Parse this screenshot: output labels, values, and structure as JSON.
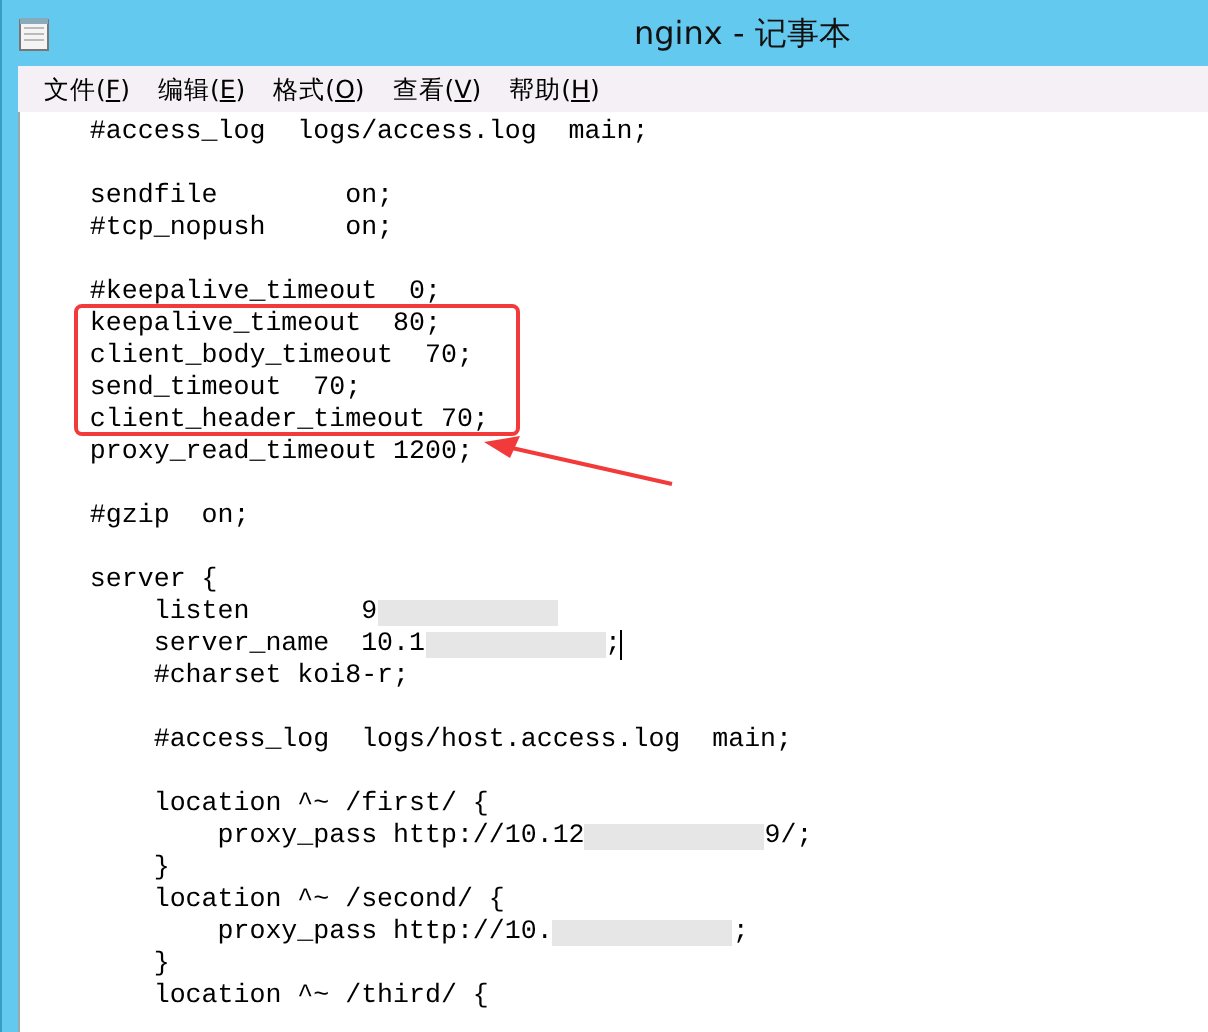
{
  "window": {
    "title": "nginx - 记事本"
  },
  "menu": [
    {
      "before": "文件(",
      "key": "F",
      "after": ")"
    },
    {
      "before": "编辑(",
      "key": "E",
      "after": ")"
    },
    {
      "before": "格式(",
      "key": "O",
      "after": ")"
    },
    {
      "before": "查看(",
      "key": "V",
      "after": ")"
    },
    {
      "before": "帮助(",
      "key": "H",
      "after": ")"
    }
  ],
  "editor": {
    "lines": [
      {
        "kind": "code",
        "parts": [
          {
            "kind": "text",
            "text": "    #access_log  logs/access.log  main;"
          }
        ]
      },
      {
        "kind": "blank"
      },
      {
        "kind": "code",
        "parts": [
          {
            "kind": "text",
            "text": "    sendfile        on;"
          }
        ]
      },
      {
        "kind": "code",
        "parts": [
          {
            "kind": "text",
            "text": "    #tcp_nopush     on;"
          }
        ]
      },
      {
        "kind": "blank"
      },
      {
        "kind": "code",
        "parts": [
          {
            "kind": "text",
            "text": "    #keepalive_timeout  0;"
          }
        ]
      },
      {
        "kind": "code",
        "parts": [
          {
            "kind": "text",
            "text": "    keepalive_timeout  80;"
          }
        ]
      },
      {
        "kind": "code",
        "parts": [
          {
            "kind": "text",
            "text": "    client_body_timeout  70;"
          }
        ]
      },
      {
        "kind": "code",
        "parts": [
          {
            "kind": "text",
            "text": "    send_timeout  70;"
          }
        ]
      },
      {
        "kind": "code",
        "parts": [
          {
            "kind": "text",
            "text": "    client_header_timeout 70;"
          }
        ]
      },
      {
        "kind": "code",
        "parts": [
          {
            "kind": "text",
            "text": "    proxy_read_timeout 1200;"
          }
        ]
      },
      {
        "kind": "blank"
      },
      {
        "kind": "code",
        "parts": [
          {
            "kind": "text",
            "text": "    #gzip  on;"
          }
        ]
      },
      {
        "kind": "blank"
      },
      {
        "kind": "code",
        "parts": [
          {
            "kind": "text",
            "text": "    server {"
          }
        ]
      },
      {
        "kind": "code",
        "parts": [
          {
            "kind": "text",
            "text": "        listen       9"
          },
          {
            "kind": "redaction"
          }
        ]
      },
      {
        "kind": "code",
        "parts": [
          {
            "kind": "text",
            "text": "        server_name  10.1"
          },
          {
            "kind": "redaction"
          },
          {
            "kind": "text",
            "text": ";"
          },
          {
            "kind": "cursor"
          }
        ]
      },
      {
        "kind": "code",
        "parts": [
          {
            "kind": "text",
            "text": "        #charset koi8-r;"
          }
        ]
      },
      {
        "kind": "blank"
      },
      {
        "kind": "code",
        "parts": [
          {
            "kind": "text",
            "text": "        #access_log  logs/host.access.log  main;"
          }
        ]
      },
      {
        "kind": "blank"
      },
      {
        "kind": "code",
        "parts": [
          {
            "kind": "text",
            "text": "        location ^~ /first/ {"
          }
        ]
      },
      {
        "kind": "code",
        "parts": [
          {
            "kind": "text",
            "text": "            proxy_pass http://10.12"
          },
          {
            "kind": "redaction"
          },
          {
            "kind": "text",
            "text": "9/;"
          }
        ]
      },
      {
        "kind": "code",
        "parts": [
          {
            "kind": "text",
            "text": "        }"
          }
        ]
      },
      {
        "kind": "code",
        "parts": [
          {
            "kind": "text",
            "text": "        location ^~ /second/ {"
          }
        ]
      },
      {
        "kind": "code",
        "parts": [
          {
            "kind": "text",
            "text": "            proxy_pass http://10."
          },
          {
            "kind": "redaction"
          },
          {
            "kind": "text",
            "text": ";"
          }
        ]
      },
      {
        "kind": "code",
        "parts": [
          {
            "kind": "text",
            "text": "        }"
          }
        ]
      },
      {
        "kind": "code",
        "parts": [
          {
            "kind": "text",
            "text": "        location ^~ /third/ {"
          }
        ]
      }
    ]
  },
  "annotations": {
    "highlight_box": true,
    "arrow": true
  }
}
